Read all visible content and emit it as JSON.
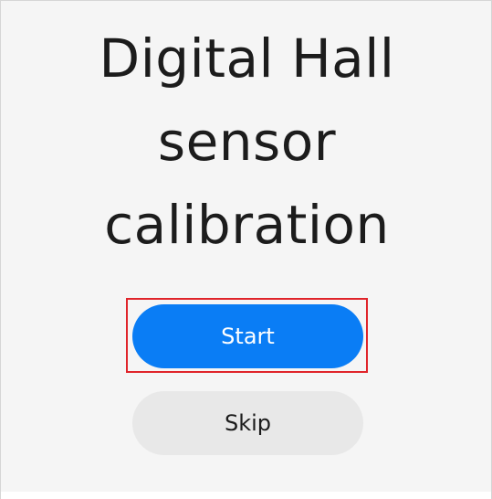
{
  "title_lines": [
    "Digital Hall",
    "sensor",
    "calibration"
  ],
  "buttons": {
    "start_label": "Start",
    "skip_label": "Skip"
  },
  "colors": {
    "primary": "#0a7df5",
    "secondary": "#e8e8e8",
    "highlight": "#e0242a",
    "background": "#f5f5f5"
  }
}
